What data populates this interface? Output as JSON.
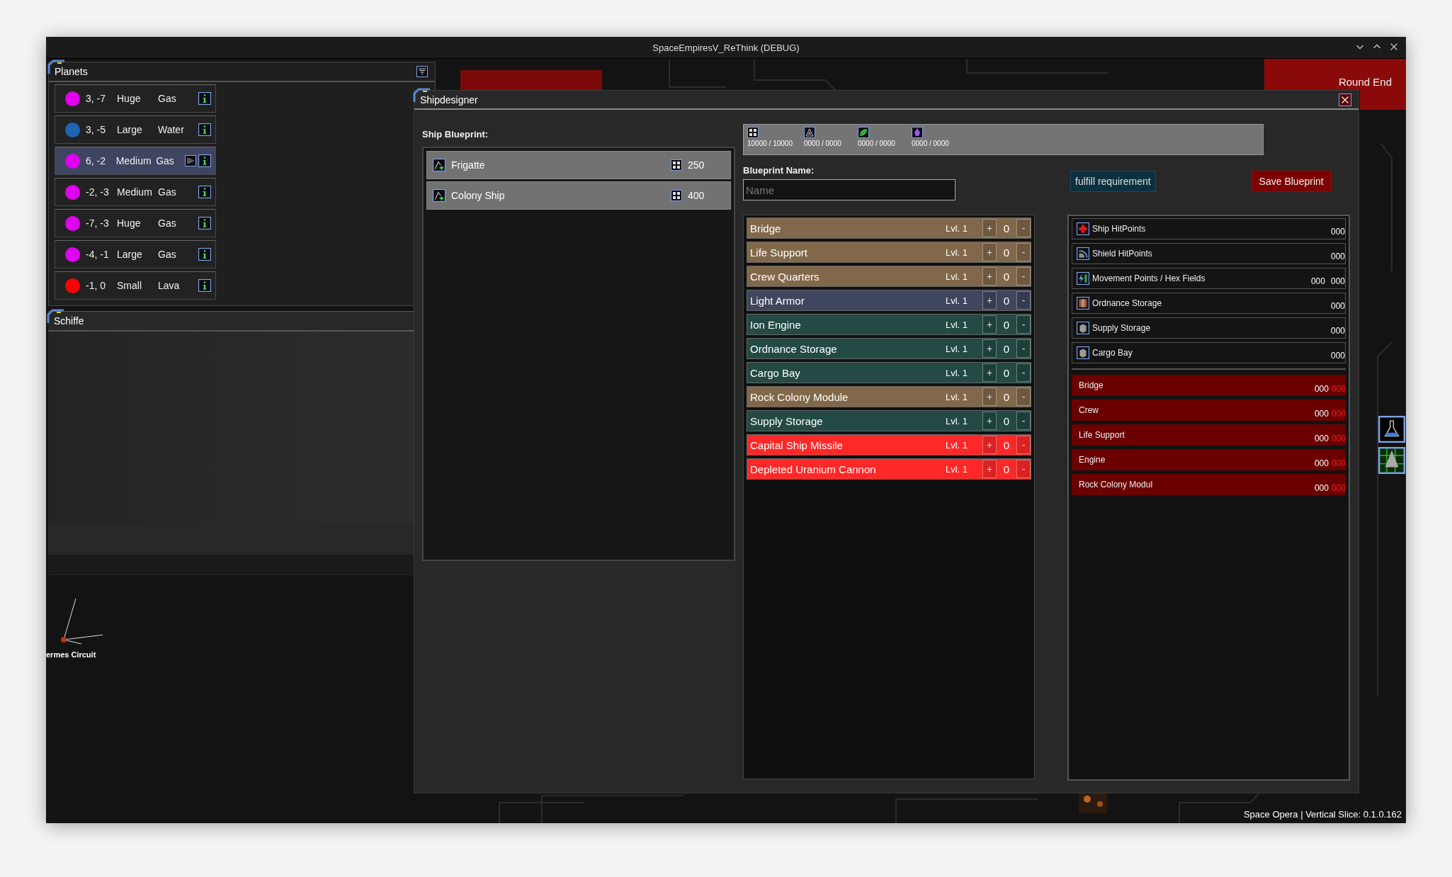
{
  "window": {
    "title": "SpaceEmpiresV_ReThink (DEBUG)"
  },
  "planets_panel": {
    "title": "Planets",
    "planets": [
      {
        "coords": "3, -7",
        "size": "Huge",
        "type": "Gas",
        "color": "#e000f0",
        "selected": false
      },
      {
        "coords": "3, -5",
        "size": "Large",
        "type": "Water",
        "color": "#1f64b4",
        "selected": false
      },
      {
        "coords": "6, -2",
        "size": "Medium",
        "type": "Gas",
        "color": "#e000f0",
        "selected": true
      },
      {
        "coords": "-2, -3",
        "size": "Medium",
        "type": "Gas",
        "color": "#e000f0",
        "selected": false
      },
      {
        "coords": "-7, -3",
        "size": "Huge",
        "type": "Gas",
        "color": "#e000f0",
        "selected": false
      },
      {
        "coords": "-4, -1",
        "size": "Large",
        "type": "Gas",
        "color": "#e000f0",
        "selected": false
      },
      {
        "coords": "-1, 0",
        "size": "Small",
        "type": "Lava",
        "color": "#ff0000",
        "selected": false
      }
    ]
  },
  "ships_panel": {
    "title": "Schiffe"
  },
  "star_map": {
    "label": "ermes Circuit"
  },
  "round_end": {
    "label": "Round End"
  },
  "ship_designer": {
    "title": "Shipdesigner",
    "blueprint_label": "Ship Blueprint:",
    "blueprints": [
      {
        "name": "Frigatte",
        "cost": "250"
      },
      {
        "name": "Colony Ship",
        "cost": "400"
      }
    ],
    "resources": [
      {
        "kind": "industry",
        "amount": "10000 / 10000"
      },
      {
        "kind": "research",
        "amount": "0000 / 0000"
      },
      {
        "kind": "organics",
        "amount": "0000 / 0000"
      },
      {
        "kind": "radioactives",
        "amount": "0000 / 0000"
      }
    ],
    "name_label": "Blueprint Name:",
    "name_field": {
      "placeholder": "Name"
    },
    "fulfill_button": "fulfill requirement",
    "save_button": "Save Blueprint",
    "plus_label": "+",
    "minus_label": "-",
    "modules": [
      {
        "name": "Bridge",
        "level_text": "Lvl. 1",
        "count": "0",
        "color": "#82684a"
      },
      {
        "name": "Life Support",
        "level_text": "Lvl. 1",
        "count": "0",
        "color": "#82684a"
      },
      {
        "name": "Crew Quarters",
        "level_text": "Lvl. 1",
        "count": "0",
        "color": "#82684a"
      },
      {
        "name": "Light Armor",
        "level_text": "Lvl. 1",
        "count": "0",
        "color": "#3f465e"
      },
      {
        "name": "Ion Engine",
        "level_text": "Lvl. 1",
        "count": "0",
        "color": "#234a45"
      },
      {
        "name": "Ordnance Storage",
        "level_text": "Lvl. 1",
        "count": "0",
        "color": "#234a45"
      },
      {
        "name": "Cargo Bay",
        "level_text": "Lvl. 1",
        "count": "0",
        "color": "#234a45"
      },
      {
        "name": "Rock Colony Module",
        "level_text": "Lvl. 1",
        "count": "0",
        "color": "#82684a"
      },
      {
        "name": "Supply Storage",
        "level_text": "Lvl. 1",
        "count": "0",
        "color": "#234a45"
      },
      {
        "name": "Capital Ship Missile",
        "level_text": "Lvl. 1",
        "count": "0",
        "color": "#ff2828"
      },
      {
        "name": "Depleted Uranium Cannon",
        "level_text": "Lvl. 1",
        "count": "0",
        "color": "#ff2828"
      }
    ],
    "stats": [
      {
        "kind": "hitpoints",
        "label": "Ship HitPoints",
        "values": [
          "000"
        ]
      },
      {
        "kind": "shield",
        "label": "Shield HitPoints",
        "values": [
          "000"
        ]
      },
      {
        "kind": "movement",
        "label": "Movement Points / Hex Fields",
        "values": [
          "000",
          "000"
        ]
      },
      {
        "kind": "ordnance",
        "label": "Ordnance Storage",
        "values": [
          "000"
        ]
      },
      {
        "kind": "supply",
        "label": "Supply Storage",
        "values": [
          "000"
        ]
      },
      {
        "kind": "cargo",
        "label": "Cargo Bay",
        "values": [
          "000"
        ]
      }
    ],
    "requirements": [
      {
        "label": "Bridge",
        "value": "000",
        "required": "000"
      },
      {
        "label": "Crew",
        "value": "000",
        "required": "000"
      },
      {
        "label": "Life Support",
        "value": "000",
        "required": "000"
      },
      {
        "label": "Engine",
        "value": "000",
        "required": "000"
      },
      {
        "label": "Rock Colony Modul",
        "value": "000",
        "required": "000"
      }
    ]
  },
  "status_bar": {
    "text": "Space Opera | Vertical Slice: 0.1.0.162"
  }
}
